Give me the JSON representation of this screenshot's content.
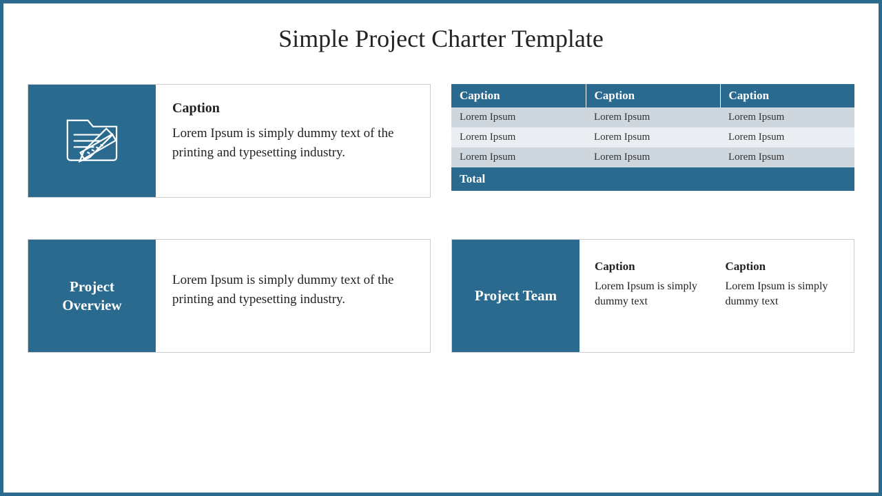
{
  "title": "Simple Project Charter Template",
  "iconCard": {
    "caption": "Caption",
    "text": "Lorem Ipsum is simply dummy text of the printing and typesetting industry."
  },
  "overview": {
    "label": "Project Overview",
    "text": "Lorem Ipsum is simply dummy text of the printing and typesetting industry."
  },
  "team": {
    "label": "Project Team",
    "col1": {
      "caption": "Caption",
      "text": "Lorem Ipsum is simply dummy text"
    },
    "col2": {
      "caption": "Caption",
      "text": "Lorem Ipsum is simply dummy text"
    }
  },
  "table": {
    "headers": [
      "Caption",
      "Caption",
      "Caption"
    ],
    "rows": [
      [
        "Lorem Ipsum",
        "Lorem Ipsum",
        "Lorem Ipsum"
      ],
      [
        "Lorem Ipsum",
        "Lorem Ipsum",
        "Lorem Ipsum"
      ],
      [
        "Lorem Ipsum",
        "Lorem Ipsum",
        "Lorem Ipsum"
      ]
    ],
    "total_label": "Total"
  }
}
